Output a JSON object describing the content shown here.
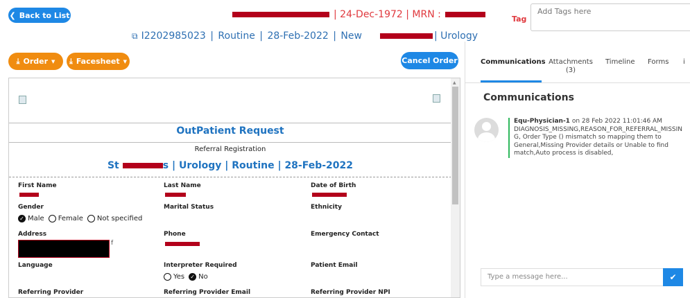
{
  "header": {
    "back_label": "Back to List",
    "patient_line_visible": "| 24-Dec-1972 | MRN :",
    "order_id": "I2202985023",
    "priority": "Routine",
    "date": "28-Feb-2022",
    "status": "New",
    "dept": "| Urology",
    "sep": " | ",
    "tag_label": "Tag",
    "tag_placeholder": "Add Tags here"
  },
  "toolbar": {
    "order_label": "Order",
    "facesheet_label": "Facesheet",
    "cancel_label": "Cancel Order"
  },
  "form": {
    "title": "OutPatient Request",
    "subtitle": "Referral Registration",
    "facility_prefix": "St",
    "facility_suffix": "s | Urology | Routine | 28-Feb-2022",
    "first_name": "First Name",
    "last_name": "Last Name",
    "dob": "Date of Birth",
    "gender": "Gender",
    "gender_opts": [
      "Male",
      "Female",
      "Not specified"
    ],
    "marital": "Marital Status",
    "ethnicity": "Ethnicity",
    "address": "Address",
    "address_suffix": "f",
    "phone": "Phone",
    "emergency": "Emergency Contact",
    "language": "Language",
    "interpreter": "Interpreter Required",
    "interp_opts": [
      "Yes",
      "No"
    ],
    "patient_email": "Patient Email",
    "ref_provider": "Referring Provider",
    "ref_email": "Referring Provider Email",
    "ref_npi": "Referring Provider NPI"
  },
  "panel": {
    "tabs": [
      "Communications",
      "Attachments",
      "(3)",
      "Timeline",
      "Forms",
      "i"
    ],
    "heading": "Communications",
    "message": {
      "author": "Equ-Physician-1",
      "time": " on 28 Feb 2022 11:01:46 AM",
      "text": "DIAGNOSIS_MISSING,REASON_FOR_REFERRAL_MISSING, Order Type () mismatch so mapping them to General,Missing Provider details or Unable to find match,Auto process is disabled,"
    },
    "input_placeholder": "Type a message here..."
  },
  "colors": {
    "blue": "#1e88e5",
    "orange": "#f08c10",
    "redact": "#b3001b"
  }
}
